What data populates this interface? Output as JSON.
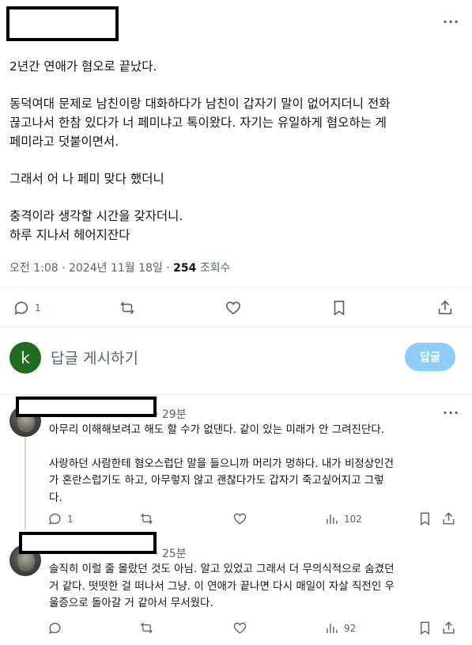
{
  "post": {
    "paragraphs": [
      {
        "lines": [
          "2년간 연애가 혐오로 끝났다."
        ]
      },
      {
        "lines": [
          "동덕여대 문제로 남친이랑 대화하다가 남친이 갑자기 말이 없어지더니 전화",
          "끊고나서 한참 있다가 너 페미냐고 톡이왔다. 자기는 유일하게 혐오하는 게",
          "페미라고 덧붙이면서."
        ]
      },
      {
        "lines": [
          "그래서 어 나 페미 맞다 했더니"
        ]
      },
      {
        "lines": [
          "충격이라 생각할 시간을 갖자더니.",
          "하루 지나서 헤어지잔다"
        ]
      }
    ],
    "timestamp": "오전 1:08 · 2024년 11월 18일 · ",
    "views_count": "254",
    "views_label": " 조회수",
    "reply_count": "1"
  },
  "composer": {
    "avatar_letter": "k",
    "placeholder": "답글 게시하기",
    "button_label": "답글"
  },
  "replies": [
    {
      "time": "· 29분",
      "paragraphs": [
        {
          "lines": [
            "아무리 이해해보려고 해도 할 수가 없댄다. 같이 있는 미래가 안 그려진단다."
          ]
        },
        {
          "lines": [
            "사랑하던 사람한테 혐오스럽단 말을 들으니까 머리가 멍하다. 내가 비정상인건",
            "가 혼란스럽기도 하고, 아무렇지 않고 괜찮다가도 갑자기 죽고싶어지고 그렇",
            "다."
          ]
        }
      ],
      "reply_count": "1",
      "views": "102"
    },
    {
      "time": "· 25분",
      "paragraphs": [
        {
          "lines": [
            "솔직히 이럴 줄 몰랐던 것도 아님. 알고 있었고 그래서 더 무의식적으로 숨겼던",
            "거 같다. 떳떳한 걸 떠나서 그냥. 이 연애가 끝나면 다시 매일이 자살 직전인 우",
            "울증으로 돌아갈 거 같아서 무서웠다."
          ]
        }
      ],
      "reply_count": "",
      "views": "92"
    }
  ],
  "icons": {
    "reply": "speech-bubble-icon",
    "repost": "repost-icon",
    "like": "heart-icon",
    "bookmark": "bookmark-icon",
    "share": "share-icon",
    "views": "bar-chart-icon",
    "more": "more-icon"
  },
  "colors": {
    "text": "#0f1419",
    "secondary": "#536471",
    "reply_button": "#8ecdf7",
    "composer_avatar": "#1f6b1f",
    "divider": "#eff3f4"
  }
}
